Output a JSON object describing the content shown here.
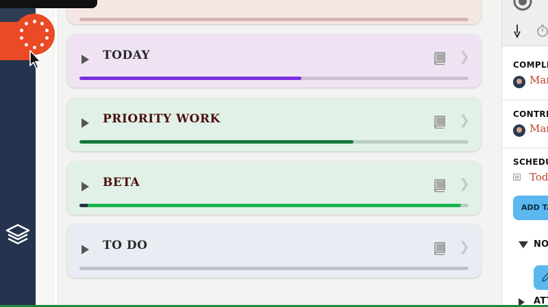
{
  "lists": [
    {
      "title": "",
      "progress": 0.0,
      "colors": {
        "bg": "#f6e6e3",
        "title": "#3b1e1e",
        "track": "#d3b6b3",
        "fill": "#d3b6b3"
      }
    },
    {
      "title": "TODAY",
      "progress": 0.57,
      "colors": {
        "bg": "#efe3f3",
        "title": "#2a2a2a",
        "track": "#cbbfd3",
        "fill": "#7b2ee3"
      }
    },
    {
      "title": "PRIORITY WORK",
      "progress": 0.705,
      "colors": {
        "bg": "#e2f1e7",
        "title": "#4a1010",
        "track": "#b9cfc0",
        "fill": "#0f7a3c"
      }
    },
    {
      "title": "BETA",
      "progress": 0.98,
      "colors": {
        "bg": "#e2f1e7",
        "title": "#4a1010",
        "track": "#b9cfc0",
        "fill": "#18b24f"
      }
    },
    {
      "title": "TO DO",
      "progress": 0.0,
      "colors": {
        "bg": "#e9edf3",
        "title": "#2a2a2a",
        "track": "#bcc2cd",
        "fill": "#bcc2cd"
      }
    }
  ],
  "side_panel": {
    "completed_header": "COMPLE",
    "completed_value": "Mar",
    "contrib_header": "CONTRI",
    "contrib_value": "Mar",
    "schedule_header": "SCHEDU",
    "schedule_value": "Toda",
    "add_task_label": "ADD TA",
    "notes_header": "NO",
    "attachments_header": "ATT"
  },
  "icons": {
    "nav_dial": "dial-icon",
    "nav_layers": "layers-icon",
    "list_expand": "play-triangle-icon",
    "list_notes": "book-icon",
    "list_open": "chevron-right-icon"
  },
  "colors": {
    "nav_bg": "#24344f",
    "accent_red": "#ea4a25",
    "link_red": "#c0422a",
    "button_blue": "#5bb8ef"
  }
}
